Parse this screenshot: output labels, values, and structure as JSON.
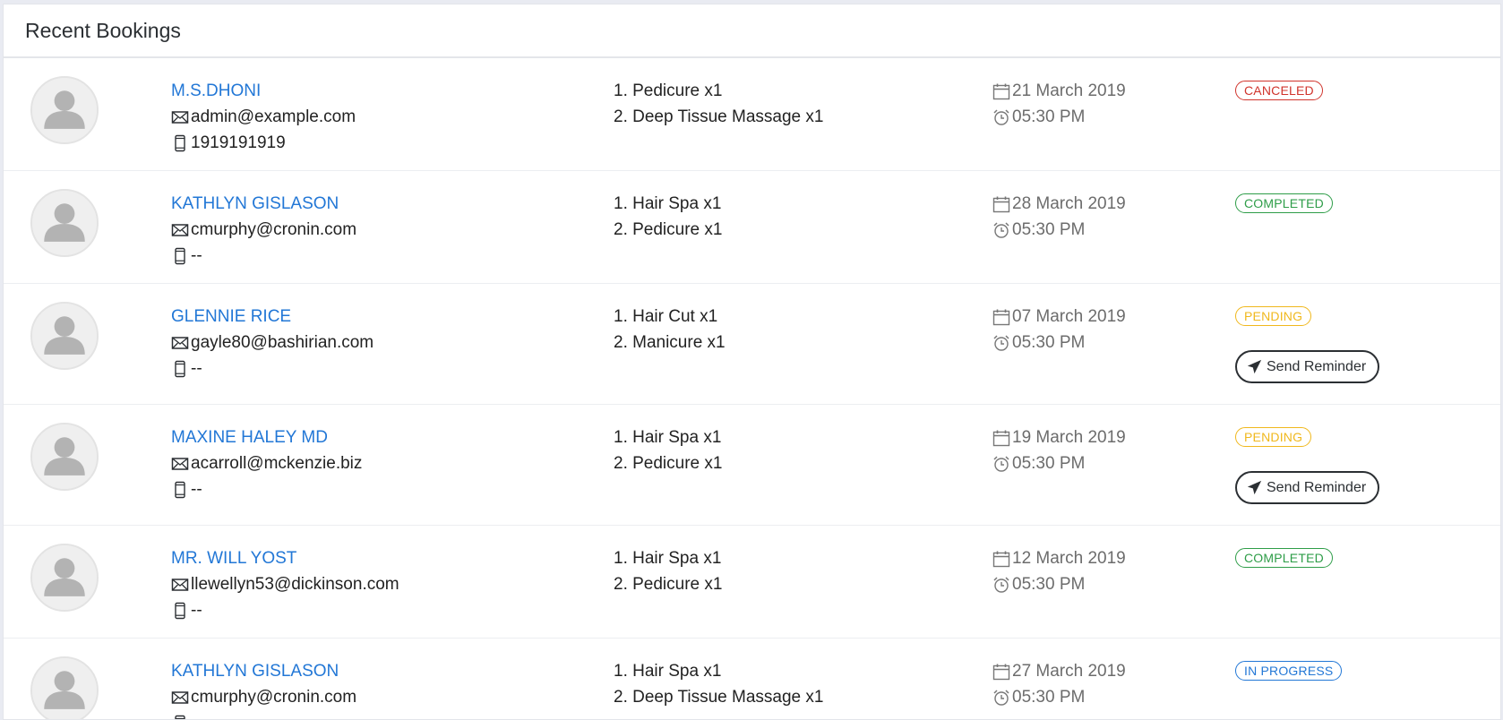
{
  "header": {
    "title": "Recent Bookings"
  },
  "bookings": [
    {
      "name": "M.S.DHONI",
      "email": "admin@example.com",
      "phone": "1919191919",
      "services": [
        "1. Pedicure x1",
        "2. Deep Tissue Massage x1"
      ],
      "date": "21 March 2019",
      "time": "05:30 PM",
      "status": "CANCELED",
      "action": null
    },
    {
      "name": "KATHLYN GISLASON",
      "email": "cmurphy@cronin.com",
      "phone": "--",
      "services": [
        "1. Hair Spa x1",
        "2. Pedicure x1"
      ],
      "date": "28 March 2019",
      "time": "05:30 PM",
      "status": "COMPLETED",
      "action": null
    },
    {
      "name": "GLENNIE RICE",
      "email": "gayle80@bashirian.com",
      "phone": "--",
      "services": [
        "1. Hair Cut x1",
        "2. Manicure x1"
      ],
      "date": "07 March 2019",
      "time": "05:30 PM",
      "status": "PENDING",
      "action": "Send Reminder"
    },
    {
      "name": "MAXINE HALEY MD",
      "email": "acarroll@mckenzie.biz",
      "phone": "--",
      "services": [
        "1. Hair Spa x1",
        "2. Pedicure x1"
      ],
      "date": "19 March 2019",
      "time": "05:30 PM",
      "status": "PENDING",
      "action": "Send Reminder"
    },
    {
      "name": "MR. WILL YOST",
      "email": "llewellyn53@dickinson.com",
      "phone": "--",
      "services": [
        "1. Hair Spa x1",
        "2. Pedicure x1"
      ],
      "date": "12 March 2019",
      "time": "05:30 PM",
      "status": "COMPLETED",
      "action": null
    },
    {
      "name": "KATHLYN GISLASON",
      "email": "cmurphy@cronin.com",
      "phone": "--",
      "services": [
        "1. Hair Spa x1",
        "2. Deep Tissue Massage x1"
      ],
      "date": "27 March 2019",
      "time": "05:30 PM",
      "status": "IN PROGRESS",
      "action": null
    }
  ],
  "icons": {
    "email": "envelope-icon",
    "phone": "mobile-phone-icon",
    "date": "calendar-icon",
    "time": "alarm-clock-icon",
    "reminder": "paper-plane-icon",
    "avatar": "user-placeholder-icon"
  },
  "colors": {
    "link": "#2277d6",
    "canceled": "#d0342c",
    "completed": "#2e9d48",
    "pending": "#f0b81d",
    "in_progress": "#2277d6"
  }
}
